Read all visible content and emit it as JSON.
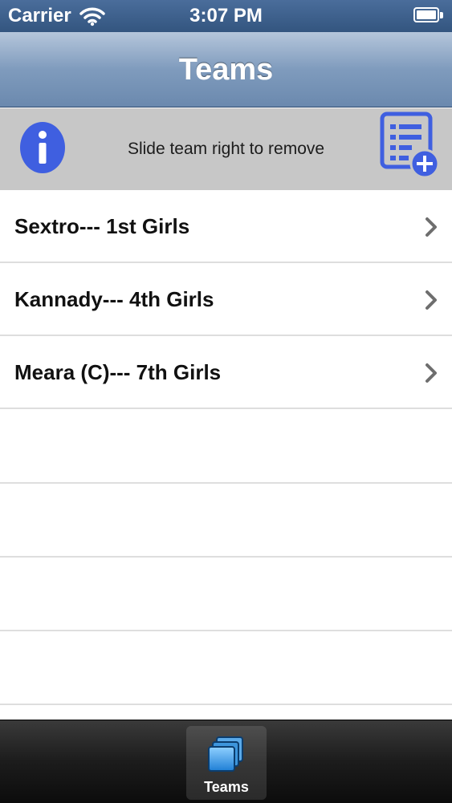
{
  "status_bar": {
    "carrier": "Carrier",
    "time": "3:07 PM",
    "icons": [
      "wifi-icon",
      "battery-icon"
    ]
  },
  "nav_bar": {
    "title": "Teams"
  },
  "info_banner": {
    "icon": "info-icon",
    "text": "Slide team right to remove",
    "add_icon": "add-list-icon",
    "accent_color": "#3f5fe0"
  },
  "teams": [
    {
      "label": "Sextro--- 1st Girls"
    },
    {
      "label": "Kannady--- 4th Girls"
    },
    {
      "label": "Meara (C)--- 7th Girls"
    }
  ],
  "tab_bar": {
    "items": [
      {
        "label": "Teams",
        "icon": "teams-stack-icon",
        "selected": true
      }
    ]
  }
}
